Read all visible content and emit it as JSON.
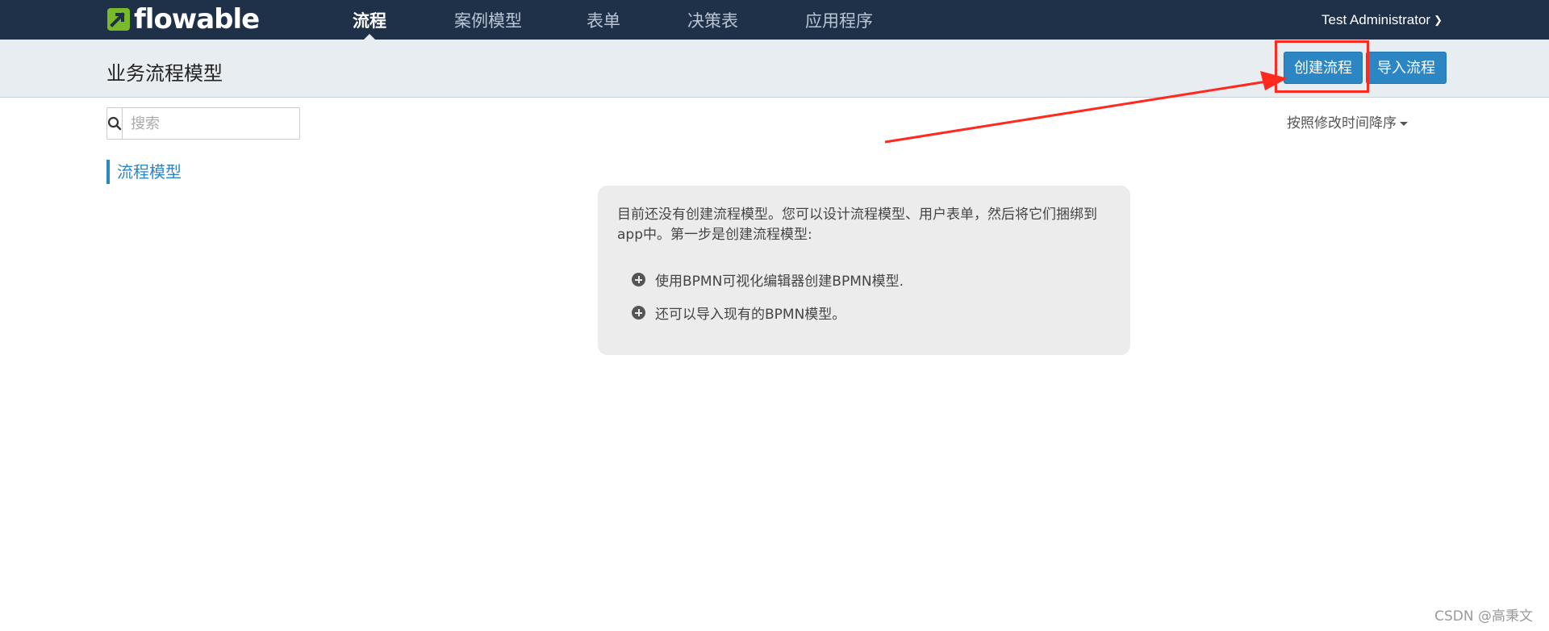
{
  "navbar": {
    "logo_text": "flowable",
    "items": [
      {
        "label": "流程",
        "active": true
      },
      {
        "label": "案例模型",
        "active": false
      },
      {
        "label": "表单",
        "active": false
      },
      {
        "label": "决策表",
        "active": false
      },
      {
        "label": "应用程序",
        "active": false
      }
    ],
    "user": "Test Administrator"
  },
  "header": {
    "title": "业务流程模型",
    "create_label": "创建流程",
    "import_label": "导入流程"
  },
  "search": {
    "placeholder": "搜索",
    "value": ""
  },
  "sort": {
    "label": "按照修改时间降序"
  },
  "sidebar": {
    "active_item": "流程模型"
  },
  "empty_state": {
    "message": "目前还没有创建流程模型。您可以设计流程模型、用户表单，然后将它们捆绑到app中。第一步是创建流程模型:",
    "items": [
      "使用BPMN可视化编辑器创建BPMN模型.",
      "还可以导入现有的BPMN模型。"
    ]
  },
  "watermark": "CSDN @高秉文",
  "colors": {
    "navbar_bg": "#1f3148",
    "subheader_bg": "#e8edf1",
    "primary": "#2d86c4",
    "annotation": "#ff2a1f",
    "logo_green": "#7ab929"
  }
}
